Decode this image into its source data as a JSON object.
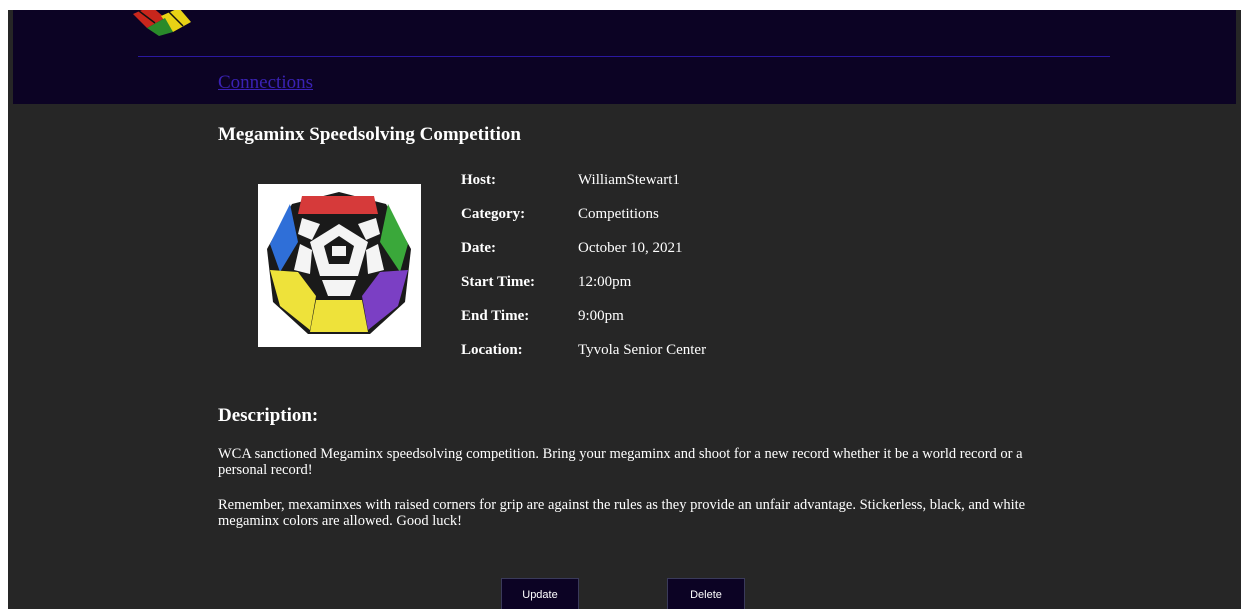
{
  "nav": {
    "connections_link": "Connections"
  },
  "event": {
    "title": "Megaminx Speedsolving Competition",
    "details": [
      {
        "label": "Host:",
        "value": "WilliamStewart1"
      },
      {
        "label": "Category:",
        "value": "Competitions"
      },
      {
        "label": "Date:",
        "value": "October 10, 2021"
      },
      {
        "label": "Start Time:",
        "value": "12:00pm"
      },
      {
        "label": "End Time:",
        "value": "9:00pm"
      },
      {
        "label": "Location:",
        "value": "Tyvola Senior Center"
      }
    ],
    "image_icon": "megaminx-puzzle-image"
  },
  "description": {
    "heading": "Description:",
    "paragraphs": [
      "WCA sanctioned Megaminx speedsolving competition. Bring your megaminx and shoot for a new record whether it be a world record or a personal record!",
      "Remember, mexaminxes with raised corners for grip are against the rules as they provide an unfair advantage. Stickerless, black, and white megaminx colors are allowed. Good luck!"
    ]
  },
  "actions": {
    "update_label": "Update",
    "delete_label": "Delete"
  },
  "colors": {
    "page_bg": "#262626",
    "header_bg": "#0c0324",
    "link": "#3a22b4",
    "button_bg": "#0c0324"
  }
}
